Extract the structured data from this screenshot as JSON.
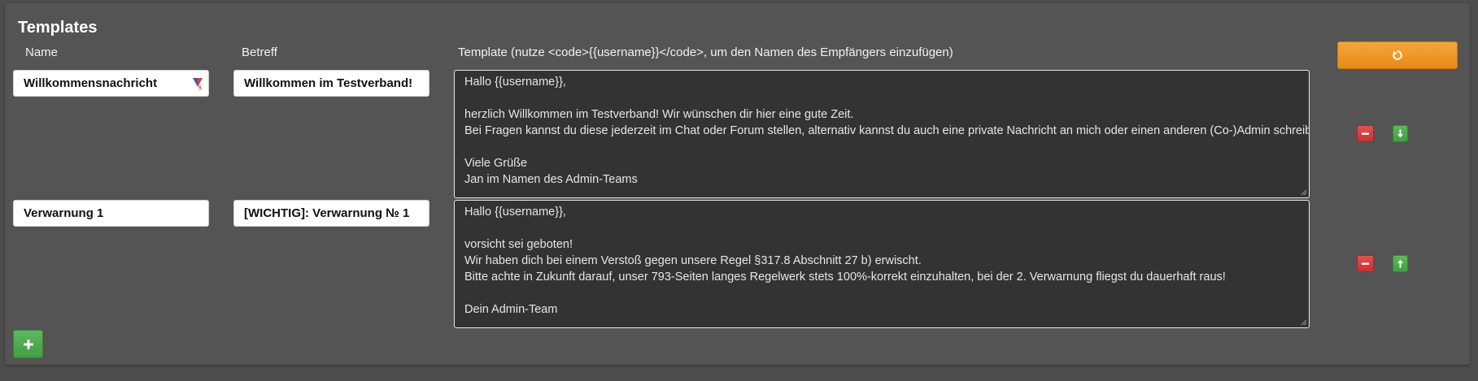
{
  "section": {
    "title": "Templates"
  },
  "columns": {
    "name": "Name",
    "subject": "Betreff",
    "template": "Template (nutze <code>{{username}}</code>, um den Namen des Empfängers einzufügen)"
  },
  "templates": [
    {
      "name": "Willkommensnachricht",
      "subject": "Willkommen im Testverband!",
      "body_lines": [
        "Hallo {{username}},",
        "",
        "herzlich Willkommen im Testverband! Wir wünschen dir hier eine gute Zeit.",
        "Bei Fragen kannst du diese jederzeit im Chat oder Forum stellen, alternativ kannst du auch eine private Nachricht an mich oder einen anderen (Co-)Admin schreiben.",
        "",
        "Viele Grüße",
        "Jan im Namen des Admin-Teams"
      ],
      "move_icon": "arrow-down-icon"
    },
    {
      "name": "Verwarnung 1",
      "subject": "[WICHTIG]: Verwarnung № 1",
      "body_lines": [
        "Hallo {{username}},",
        "",
        "vorsicht sei geboten!",
        "Wir haben dich bei einem Verstoß gegen unsere Regel §317.8 Abschnitt 27 b) erwischt.",
        "Bitte achte in Zukunft darauf, unser 793-Seiten langes Regelwerk stets 100%-korrekt einzuhalten, bei der 2. Verwarnung fliegst du dauerhaft raus!",
        "",
        "Dein Admin-Team"
      ],
      "move_icon": "arrow-up-icon"
    }
  ],
  "buttons": {
    "reset_icon": "reset-icon",
    "remove_icon": "minus-icon",
    "add_icon": "plus-icon"
  },
  "colors": {
    "orange": "#ee961f",
    "red": "#d64040",
    "green": "#4cae4c",
    "textarea_bg": "#333333"
  }
}
